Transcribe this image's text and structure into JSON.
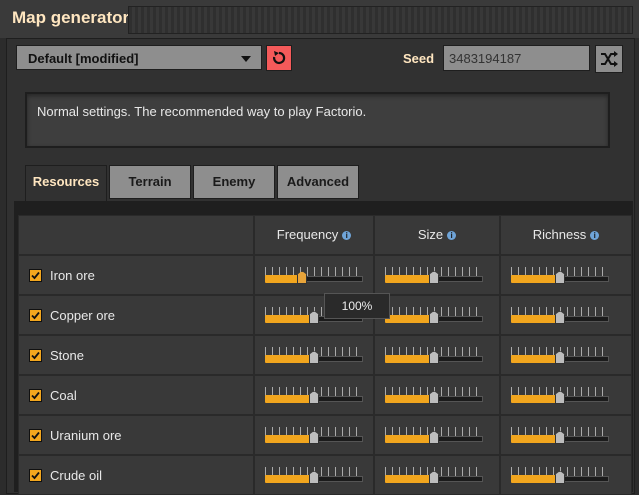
{
  "window": {
    "title": "Map generator"
  },
  "preset": {
    "label": "Default [modified]"
  },
  "seed": {
    "label": "Seed",
    "value": "3483194187"
  },
  "description": "Normal settings. The recommended way to play Factorio.",
  "tabs": [
    {
      "label": "Resources",
      "active": true
    },
    {
      "label": "Terrain",
      "active": false
    },
    {
      "label": "Enemy",
      "active": false
    },
    {
      "label": "Advanced",
      "active": false
    }
  ],
  "columns": [
    "Frequency",
    "Size",
    "Richness"
  ],
  "resources": [
    {
      "name": "Iron ore",
      "checked": true,
      "frequency": 0.38,
      "size": 0.5,
      "richness": 0.5
    },
    {
      "name": "Copper ore",
      "checked": true,
      "frequency": 0.5,
      "size": 0.5,
      "richness": 0.5
    },
    {
      "name": "Stone",
      "checked": true,
      "frequency": 0.5,
      "size": 0.5,
      "richness": 0.5
    },
    {
      "name": "Coal",
      "checked": true,
      "frequency": 0.5,
      "size": 0.5,
      "richness": 0.5
    },
    {
      "name": "Uranium ore",
      "checked": true,
      "frequency": 0.5,
      "size": 0.5,
      "richness": 0.5
    },
    {
      "name": "Crude oil",
      "checked": true,
      "frequency": 0.5,
      "size": 0.5,
      "richness": 0.5
    }
  ],
  "tooltip": {
    "text": "100%"
  },
  "colors": {
    "accent": "#f2a61e",
    "reset": "#f45a5a",
    "title": "#ffe6c0"
  },
  "icons": {
    "reset": "reset-icon",
    "shuffle": "shuffle-icon",
    "dropdown": "chevron-down-icon",
    "info": "info-icon",
    "check": "checkmark-icon"
  }
}
